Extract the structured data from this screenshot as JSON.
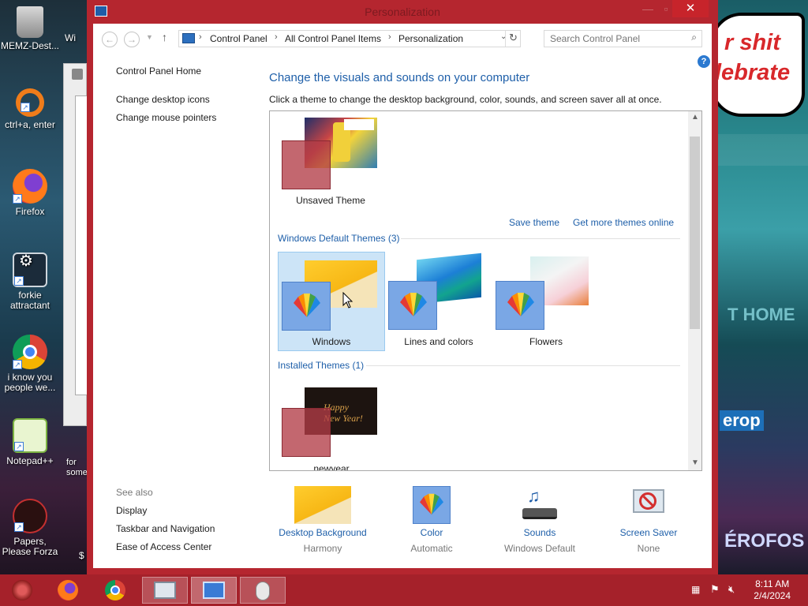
{
  "window": {
    "title": "Personalization"
  },
  "breadcrumb": {
    "items": [
      "Control Panel",
      "All Control Panel Items",
      "Personalization"
    ]
  },
  "search": {
    "placeholder": "Search Control Panel"
  },
  "sidebar": {
    "home": "Control Panel Home",
    "links": [
      "Change desktop icons",
      "Change mouse pointers"
    ],
    "see_also_title": "See also",
    "see_also": [
      "Display",
      "Taskbar and Navigation",
      "Ease of Access Center"
    ]
  },
  "main": {
    "heading": "Change the visuals and sounds on your computer",
    "subtext": "Click a theme to change the desktop background, color, sounds, and screen saver all at once.",
    "my_themes": {
      "unsaved_label": "Unsaved Theme",
      "save_theme": "Save theme",
      "get_more": "Get more themes online"
    },
    "default_section": "Windows Default Themes (3)",
    "default_themes": [
      "Windows",
      "Lines and colors",
      "Flowers"
    ],
    "installed_section": "Installed Themes (1)",
    "installed_themes": [
      "newyear"
    ],
    "newyear_art_text": [
      "Happy",
      "New Year!"
    ]
  },
  "bottom": [
    {
      "title": "Desktop Background",
      "sub": "Harmony"
    },
    {
      "title": "Color",
      "sub": "Automatic"
    },
    {
      "title": "Sounds",
      "sub": "Windows Default"
    },
    {
      "title": "Screen Saver",
      "sub": "None"
    }
  ],
  "desktop": {
    "icons": [
      "MEMZ-Dest...",
      "ctrl+a, enter",
      "Firefox",
      "forkie attractant",
      "i know you people we...",
      "Notepad++",
      "Papers, Please Forza"
    ],
    "partial_icons": [
      "Wi",
      "for some",
      "$"
    ],
    "wallpaper_speech": [
      "r shit",
      "lebrate"
    ],
    "wallpaper_words": [
      "T HOME",
      "erop",
      "ÉROFOS"
    ]
  },
  "taskbar": {
    "time": "8:11 AM",
    "date": "2/4/2024"
  },
  "colors": {
    "window_frame": "#b5262f",
    "taskbar": "#a5212a",
    "link": "#1e5fa9",
    "selection": "#cce4f7"
  }
}
